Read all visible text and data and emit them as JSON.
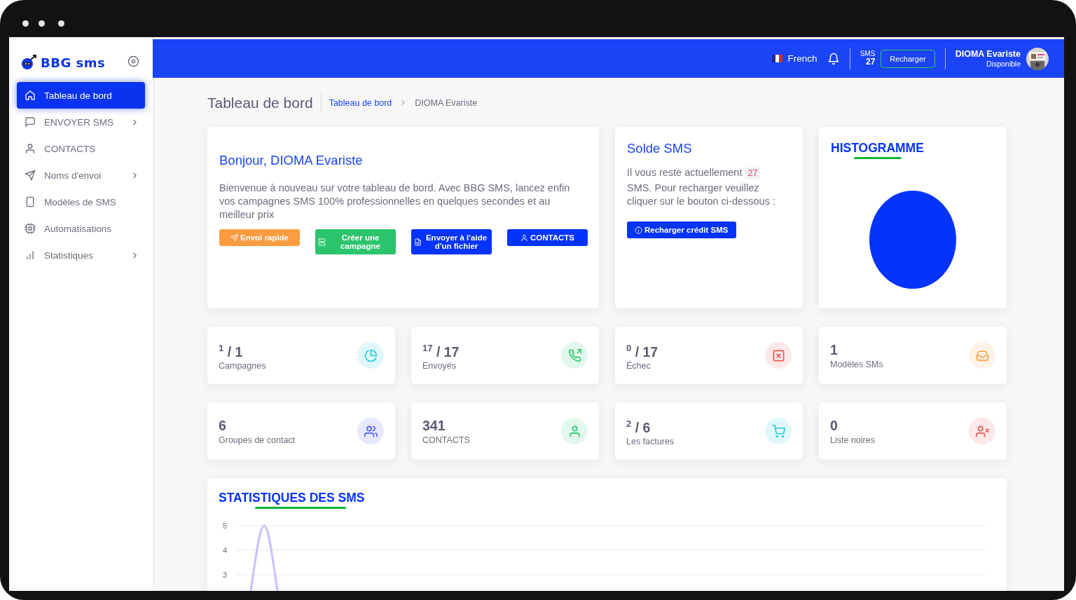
{
  "sidebar": {
    "logo": "BBG sms",
    "items": [
      {
        "label": "Tableau de bord",
        "selected": true,
        "expandable": false
      },
      {
        "label": "ENVOYER SMS",
        "selected": false,
        "expandable": true
      },
      {
        "label": "CONTACTS",
        "selected": false,
        "expandable": false
      },
      {
        "label": "Noms d'envoi",
        "selected": false,
        "expandable": true
      },
      {
        "label": "Modèles de SMS",
        "selected": false,
        "expandable": false
      },
      {
        "label": "Automatisations",
        "selected": false,
        "expandable": false
      },
      {
        "label": "Statistiques",
        "selected": false,
        "expandable": true
      }
    ]
  },
  "header": {
    "language": "French",
    "sms_label": "SMS",
    "sms_count": "27",
    "recharge_button": "Recharger",
    "user_name": "DIOMA Evariste",
    "user_status": "Disponible"
  },
  "page": {
    "title": "Tableau de bord",
    "breadcrumb": [
      "Tableau de bord",
      "DIOMA Evariste"
    ]
  },
  "welcome": {
    "title": "Bonjour, DIOMA Evariste",
    "text": "Bienvenue à nouveau sur votre tableau de bord. Avec BBG SMS, lancez enfin vos campagnes SMS 100% professionnelles en quelques secondes et au meilleur prix",
    "buttons": [
      {
        "label": "Envoi rapide",
        "color": "#fd9b40"
      },
      {
        "label": "Créer une campagne",
        "color": "#2bc46c"
      },
      {
        "label": "Envoyer à l'aide d'un fichier",
        "color": "#0433fc"
      },
      {
        "label": "CONTACTS",
        "color": "#0433fc"
      }
    ]
  },
  "balance": {
    "title": "Solde SMS",
    "text_before": "Il vous reste actuellement",
    "count": "27",
    "text_after": "SMS. Pour recharger veuillez cliquer sur le bouton ci-dessous :",
    "button": "Recharger crédit SMS"
  },
  "histogram": {
    "title": "HISTOGRAMME"
  },
  "stats": [
    {
      "value": "$^{1}$ / 1",
      "label": "Campagnes",
      "color": "#1ec8e0"
    },
    {
      "value": "$^{17}$ / 17",
      "label": "Envoyés",
      "color": "#28c76f"
    },
    {
      "value": "$^{0}$ / 17",
      "label": "Échec",
      "color": "#ea5455"
    },
    {
      "value": "1",
      "label": "Modèles SMs",
      "color": "#ff9f43"
    },
    {
      "value": "6",
      "label": "Groupes de contact",
      "color": "#4c5cf5"
    },
    {
      "value": "341",
      "label": "CONTACTS",
      "color": "#28c76f"
    },
    {
      "value": "$^{2}$ / 6",
      "label": "Les factures",
      "color": "#1ec8e0"
    },
    {
      "value": "0",
      "label": "Liste noires",
      "color": "#ea5455"
    }
  ],
  "statistics": {
    "title": "STATISTIQUES DES SMS",
    "axis_labels": [
      "5",
      "4",
      "3"
    ]
  }
}
